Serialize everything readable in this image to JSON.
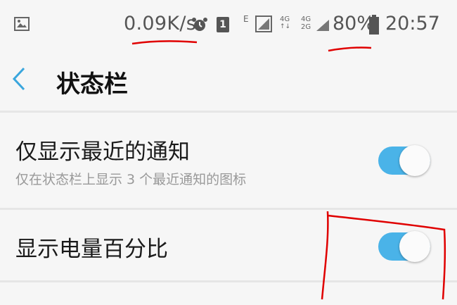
{
  "status_bar": {
    "net_speed": "0.09K/s",
    "sim_label": "1",
    "e_label": "E",
    "network_1": "4G",
    "network_2": "4G",
    "network_2b": "2G",
    "battery_pct": "80%",
    "time": "20:57"
  },
  "header": {
    "title": "状态栏"
  },
  "settings": [
    {
      "title": "仅显示最近的通知",
      "subtitle": "仅在状态栏上显示 3 个最近通知的图标",
      "enabled": true
    },
    {
      "title": "显示电量百分比",
      "enabled": true
    }
  ],
  "colors": {
    "accent": "#4ab3e8",
    "back": "#3aa6dd",
    "annotation": "#e00000"
  }
}
